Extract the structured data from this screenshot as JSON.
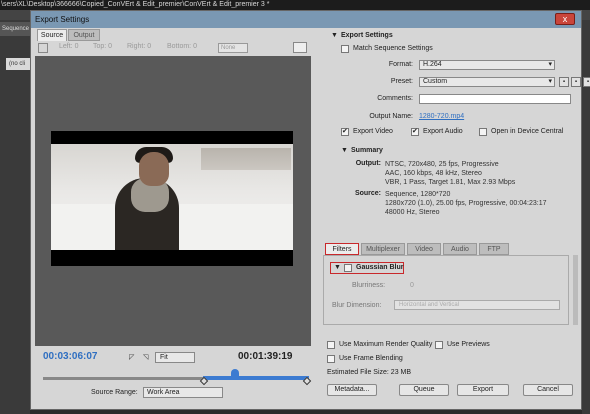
{
  "background_app": {
    "title": "\\sers\\XL\\Desktop\\366666\\Copied_ConVErt & Edit_premier\\ConVErt & Edit_premier 3 *",
    "panel_tab": "Sequence",
    "panel_item": "(no cli"
  },
  "dialog": {
    "title": "Export Settings",
    "close_label": "x"
  },
  "left": {
    "tabs": [
      "Source",
      "Output"
    ],
    "crop": {
      "left": "Left: 0",
      "top": "Top: 0",
      "right": "Right: 0",
      "bottom": "Bottom: 0",
      "ratio": "None"
    },
    "timecode_current": "00:03:06:07",
    "timecode_duration": "00:01:39:19",
    "zoom": "Fit",
    "source_range_label": "Source Range:",
    "source_range_value": "Work Area",
    "playhead_fraction": 0.72
  },
  "right": {
    "export_settings_title": "Export Settings",
    "match_sequence": "Match Sequence Settings",
    "format_label": "Format:",
    "format_value": "H.264",
    "preset_label": "Preset:",
    "preset_value": "Custom",
    "comments_label": "Comments:",
    "comments_value": "",
    "output_name_label": "Output Name:",
    "output_name_value": "1280-720.mp4",
    "export_video": "Export Video",
    "export_audio": "Export Audio",
    "open_device_central": "Open in Device Central",
    "summary_title": "Summary",
    "output_label": "Output:",
    "output_text": "NTSC, 720x480, 25 fps, Progressive\nAAC, 160 kbps, 48 kHz, Stereo\nVBR, 1 Pass, Target 1.81, Max 2.93 Mbps",
    "source_label": "Source:",
    "source_text": "Sequence, 1280*720\n1280x720 (1.0), 25.00 fps, Progressive, 00:04:23:17\n48000 Hz, Stereo",
    "tabs": [
      "Filters",
      "Multiplexer",
      "Video",
      "Audio",
      "FTP"
    ],
    "filter_name": "Gaussian Blur",
    "blurriness_label": "Blurriness:",
    "blurriness_value": "0",
    "blur_dimension_label": "Blur Dimension:",
    "blur_dimension_value": "Horizontal and Vertical",
    "use_max_render": "Use Maximum Render Quality",
    "use_previews": "Use Previews",
    "use_frame_blending": "Use Frame Blending",
    "file_size": "Estimated File Size:  23 MB",
    "buttons": {
      "metadata": "Metadata...",
      "queue": "Queue",
      "export": "Export",
      "cancel": "Cancel"
    }
  }
}
